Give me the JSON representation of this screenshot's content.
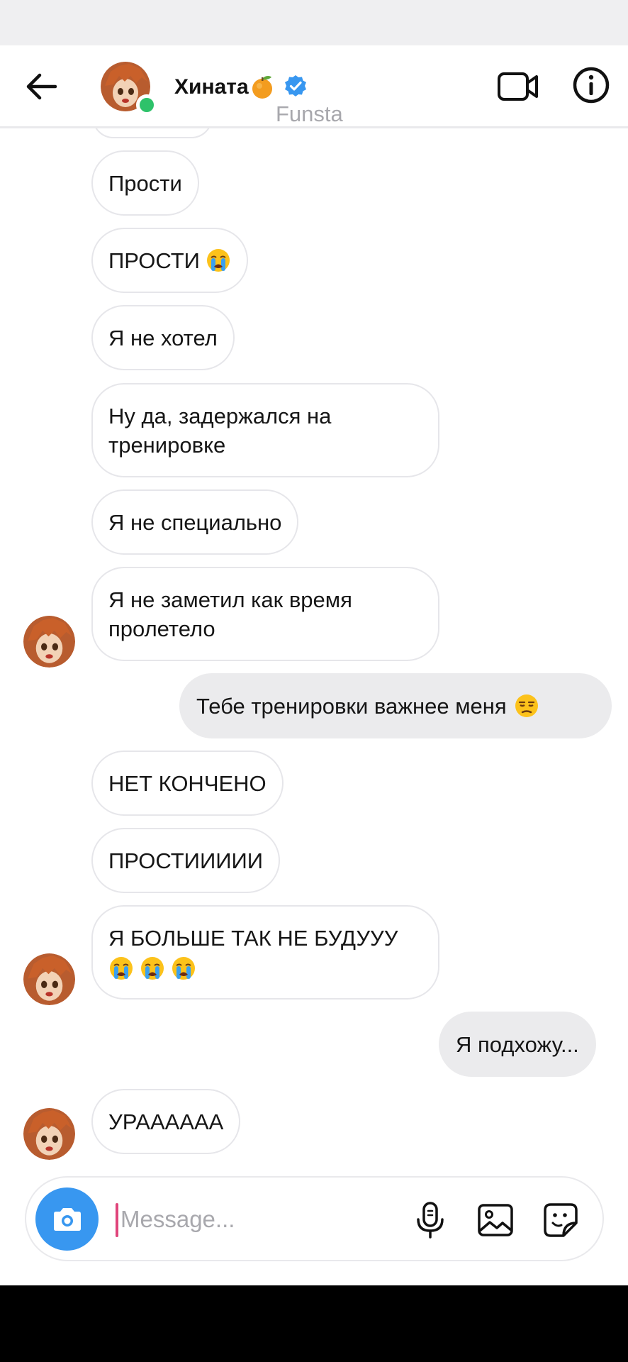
{
  "header": {
    "contact_name": "Хината",
    "name_emoji": "tangerine-emoji",
    "verified_icon": "verified-badge-icon",
    "subtitle": "Funsta"
  },
  "messages": [
    {
      "direction": "in",
      "text": "Прости"
    },
    {
      "direction": "in",
      "text": "ПРОСТИ",
      "emojis": [
        "loudly-crying-face-emoji"
      ]
    },
    {
      "direction": "in",
      "text": "Я не хотел"
    },
    {
      "direction": "in",
      "text": "Ну да, задержался на тренировке"
    },
    {
      "direction": "in",
      "text": "Я не специально"
    },
    {
      "direction": "in",
      "text": "Я не заметил как время пролетело",
      "avatar": true
    },
    {
      "direction": "out",
      "text": "Тебе тренировки важнее меня",
      "emojis": [
        "unamused-face-emoji"
      ]
    },
    {
      "direction": "in",
      "text": "НЕТ КОНЧЕНО"
    },
    {
      "direction": "in",
      "text": "ПРОСТИИИИИ"
    },
    {
      "direction": "in",
      "text": "Я БОЛЬШЕ ТАК НЕ БУДУУУ",
      "emojis": [
        "loudly-crying-face-emoji",
        "loudly-crying-face-emoji",
        "loudly-crying-face-emoji"
      ],
      "avatar": true
    },
    {
      "direction": "out",
      "text": "Я подхожу..."
    },
    {
      "direction": "in",
      "text": "УРАААААА",
      "avatar": true
    }
  ],
  "composer": {
    "placeholder": "Message...",
    "value": ""
  },
  "colors": {
    "accent": "#3897f0",
    "online": "#2ec26a",
    "outgoing_bubble": "#ebebed",
    "incoming_border": "#e6e6ea",
    "caret": "#e0457b"
  }
}
